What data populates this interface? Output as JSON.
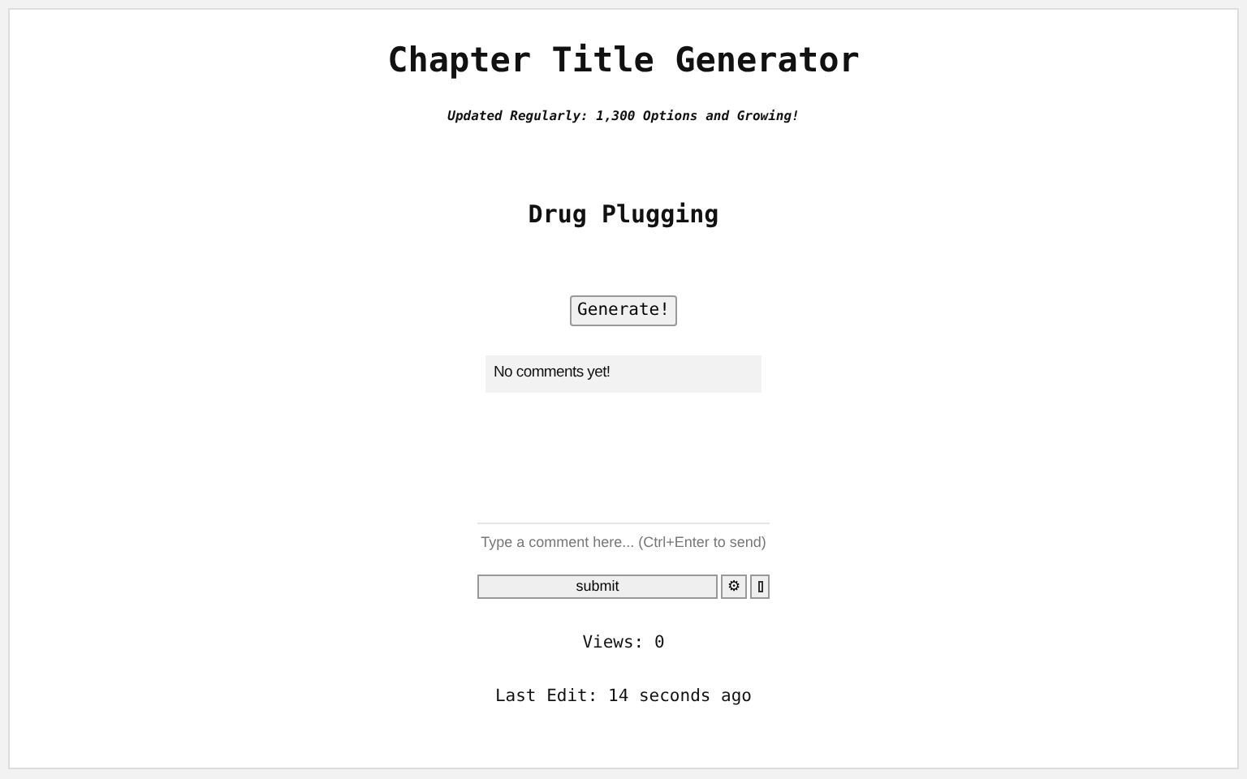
{
  "title": "Chapter Title Generator",
  "subtitle": "Updated Regularly: 1,300 Options and Growing!",
  "result": "Drug Plugging",
  "generate_button": "Generate!",
  "comments": {
    "empty_message": "No comments yet!",
    "placeholder": "Type a comment here... (Ctrl+Enter to send)",
    "submit_button": "submit",
    "settings_button": "⚙"
  },
  "views": "Views: 0",
  "last_edit": "Last Edit: 14 seconds ago"
}
